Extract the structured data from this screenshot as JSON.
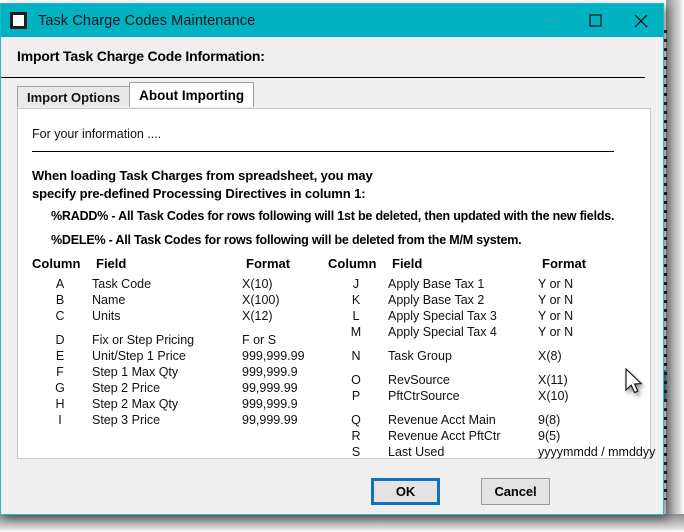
{
  "window": {
    "title": "Task Charge Codes Maintenance",
    "icon": "window-app-icon",
    "controls": [
      {
        "name": "minimize",
        "glyph": "minimize-icon",
        "enabled": false
      },
      {
        "name": "maximize",
        "glyph": "maximize-icon",
        "enabled": true
      },
      {
        "name": "close",
        "glyph": "close-icon",
        "enabled": true
      }
    ]
  },
  "header": {
    "title": "Import Task Charge Code Information:"
  },
  "tabs": [
    {
      "label": "Import Options",
      "active": false
    },
    {
      "label": "About Importing",
      "active": true
    }
  ],
  "panel": {
    "fyi": "For your information ....",
    "intro_line_1": "When loading Task Charges from spreadsheet, you may",
    "intro_line_2": "specify pre-defined Processing Directives in column 1:",
    "directives": [
      "%RADD% - All Task Codes for rows following will 1st be deleted, then updated with the new fields.",
      "%DELE% - All Task Codes for rows following will be deleted from the M/M system."
    ],
    "table_headers": {
      "column": "Column",
      "field": "Field",
      "format": "Format"
    },
    "left_rows": [
      {
        "column": "A",
        "field": "Task Code",
        "format": "X(10)",
        "gap": false
      },
      {
        "column": "B",
        "field": "Name",
        "format": "X(100)",
        "gap": false
      },
      {
        "column": "C",
        "field": "Units",
        "format": "X(12)",
        "gap": false
      },
      {
        "column": "D",
        "field": "Fix or Step Pricing",
        "format": "F or S",
        "gap": true
      },
      {
        "column": "E",
        "field": "Unit/Step 1 Price",
        "format": "999,999.99",
        "gap": false
      },
      {
        "column": "F",
        "field": "Step 1 Max Qty",
        "format": "999,999.9",
        "gap": false
      },
      {
        "column": "G",
        "field": "Step 2 Price",
        "format": "99,999.99",
        "gap": false
      },
      {
        "column": "H",
        "field": "Step 2 Max Qty",
        "format": "999,999.9",
        "gap": false
      },
      {
        "column": "I",
        "field": "Step 3 Price",
        "format": "99,999.99",
        "gap": false
      }
    ],
    "right_rows": [
      {
        "column": "J",
        "field": "Apply Base Tax 1",
        "format": "Y or N",
        "gap": false
      },
      {
        "column": "K",
        "field": "Apply Base Tax 2",
        "format": "Y or N",
        "gap": false
      },
      {
        "column": "L",
        "field": "Apply Special Tax 3",
        "format": "Y or N",
        "gap": false
      },
      {
        "column": "M",
        "field": "Apply Special Tax 4",
        "format": "Y or N",
        "gap": false
      },
      {
        "column": "N",
        "field": "Task Group",
        "format": "X(8)",
        "gap": true
      },
      {
        "column": "O",
        "field": "RevSource",
        "format": "X(11)",
        "gap": true
      },
      {
        "column": "P",
        "field": "PftCtrSource",
        "format": "X(10)",
        "gap": false
      },
      {
        "column": "Q",
        "field": "Revenue Acct Main",
        "format": "9(8)",
        "gap": true
      },
      {
        "column": "R",
        "field": "Revenue Acct PftCtr",
        "format": "9(5)",
        "gap": false
      },
      {
        "column": "S",
        "field": "Last Used",
        "format": "yyyymmdd / mmddyy",
        "gap": false
      }
    ]
  },
  "footer": {
    "ok_label": "OK",
    "cancel_label": "Cancel"
  },
  "colors": {
    "titlebar": "#00b2c2",
    "window_border": "#28b6c4",
    "focus_outline": "#1072bc",
    "panel_bg": "#ffffff",
    "dialog_bg": "#efefef"
  }
}
